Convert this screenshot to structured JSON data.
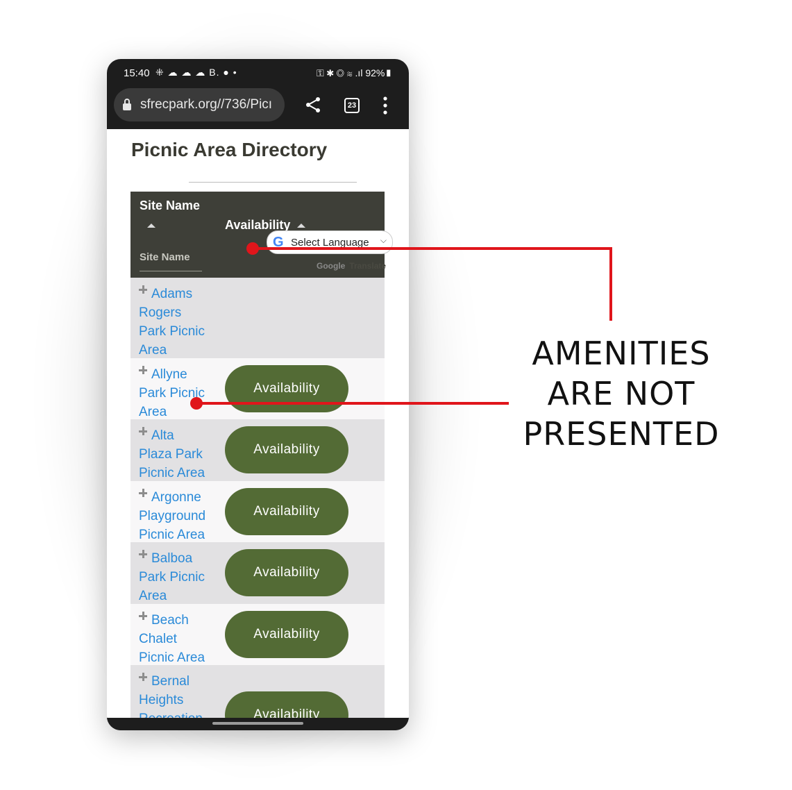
{
  "status_bar": {
    "time": "15:40",
    "notifications": "⁜ ☁ ☁ ☁ B. ● •",
    "right": "⚿ ✱ ◎ ≋ .ıl 92%▮"
  },
  "browser": {
    "url": "sfrecpark.org//736/Picı",
    "tab_count": "23"
  },
  "page": {
    "title": "Picnic Area Directory"
  },
  "table": {
    "col_site_name": "Site Name",
    "col_availability": "Availability",
    "filter_placeholder": "Site Name",
    "translate": {
      "select_label": "Select Language",
      "powered_google": "Google",
      "powered_rest": "Translate"
    },
    "button_label": "Availability",
    "rows": [
      {
        "name_lines": [
          "Adams",
          "Rogers",
          "Park Picnic",
          "Area"
        ]
      },
      {
        "name_lines": [
          "Allyne",
          "Park Picnic",
          "Area"
        ]
      },
      {
        "name_lines": [
          "Alta",
          "Plaza Park",
          "Picnic Area"
        ]
      },
      {
        "name_lines": [
          "Argonne",
          "Playground",
          "Picnic Area"
        ]
      },
      {
        "name_lines": [
          "Balboa",
          "Park Picnic",
          "Area"
        ]
      },
      {
        "name_lines": [
          "Beach",
          "Chalet",
          "Picnic Area"
        ]
      },
      {
        "name_lines": [
          "Bernal",
          "Heights",
          "Recreation"
        ]
      }
    ]
  },
  "annotation": {
    "lines": [
      "AMENITIES",
      "ARE NOT",
      "PRESENTED"
    ],
    "color": "#e0151b"
  }
}
